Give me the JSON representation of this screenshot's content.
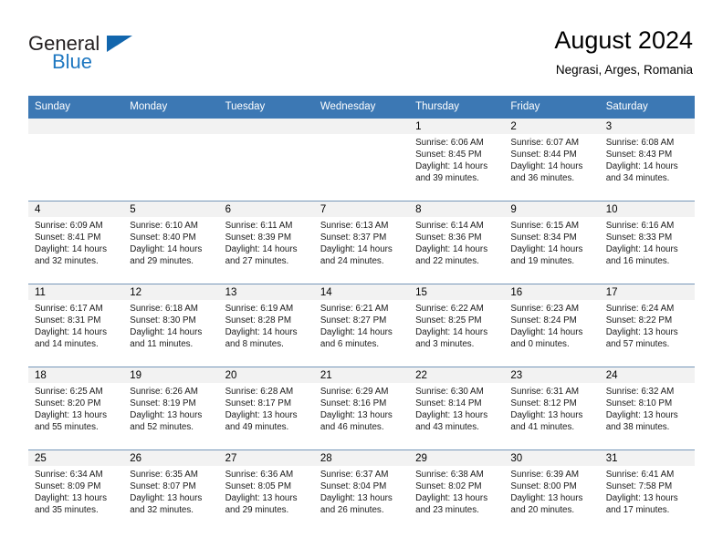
{
  "brand": {
    "name_top": "General",
    "name_bottom": "Blue",
    "triangle_color": "#1266ad",
    "blue_color": "#1f78c1"
  },
  "header": {
    "title": "August 2024",
    "subtitle": "Negrasi, Arges, Romania"
  },
  "calendar": {
    "header_bg": "#3c78b4",
    "weekdays": [
      "Sunday",
      "Monday",
      "Tuesday",
      "Wednesday",
      "Thursday",
      "Friday",
      "Saturday"
    ],
    "weeks": [
      [
        {
          "day": "",
          "empty": true
        },
        {
          "day": "",
          "empty": true
        },
        {
          "day": "",
          "empty": true
        },
        {
          "day": "",
          "empty": true
        },
        {
          "day": "1",
          "sunrise": "Sunrise: 6:06 AM",
          "sunset": "Sunset: 8:45 PM",
          "daylight": "Daylight: 14 hours and 39 minutes."
        },
        {
          "day": "2",
          "sunrise": "Sunrise: 6:07 AM",
          "sunset": "Sunset: 8:44 PM",
          "daylight": "Daylight: 14 hours and 36 minutes."
        },
        {
          "day": "3",
          "sunrise": "Sunrise: 6:08 AM",
          "sunset": "Sunset: 8:43 PM",
          "daylight": "Daylight: 14 hours and 34 minutes."
        }
      ],
      [
        {
          "day": "4",
          "sunrise": "Sunrise: 6:09 AM",
          "sunset": "Sunset: 8:41 PM",
          "daylight": "Daylight: 14 hours and 32 minutes."
        },
        {
          "day": "5",
          "sunrise": "Sunrise: 6:10 AM",
          "sunset": "Sunset: 8:40 PM",
          "daylight": "Daylight: 14 hours and 29 minutes."
        },
        {
          "day": "6",
          "sunrise": "Sunrise: 6:11 AM",
          "sunset": "Sunset: 8:39 PM",
          "daylight": "Daylight: 14 hours and 27 minutes."
        },
        {
          "day": "7",
          "sunrise": "Sunrise: 6:13 AM",
          "sunset": "Sunset: 8:37 PM",
          "daylight": "Daylight: 14 hours and 24 minutes."
        },
        {
          "day": "8",
          "sunrise": "Sunrise: 6:14 AM",
          "sunset": "Sunset: 8:36 PM",
          "daylight": "Daylight: 14 hours and 22 minutes."
        },
        {
          "day": "9",
          "sunrise": "Sunrise: 6:15 AM",
          "sunset": "Sunset: 8:34 PM",
          "daylight": "Daylight: 14 hours and 19 minutes."
        },
        {
          "day": "10",
          "sunrise": "Sunrise: 6:16 AM",
          "sunset": "Sunset: 8:33 PM",
          "daylight": "Daylight: 14 hours and 16 minutes."
        }
      ],
      [
        {
          "day": "11",
          "sunrise": "Sunrise: 6:17 AM",
          "sunset": "Sunset: 8:31 PM",
          "daylight": "Daylight: 14 hours and 14 minutes."
        },
        {
          "day": "12",
          "sunrise": "Sunrise: 6:18 AM",
          "sunset": "Sunset: 8:30 PM",
          "daylight": "Daylight: 14 hours and 11 minutes."
        },
        {
          "day": "13",
          "sunrise": "Sunrise: 6:19 AM",
          "sunset": "Sunset: 8:28 PM",
          "daylight": "Daylight: 14 hours and 8 minutes."
        },
        {
          "day": "14",
          "sunrise": "Sunrise: 6:21 AM",
          "sunset": "Sunset: 8:27 PM",
          "daylight": "Daylight: 14 hours and 6 minutes."
        },
        {
          "day": "15",
          "sunrise": "Sunrise: 6:22 AM",
          "sunset": "Sunset: 8:25 PM",
          "daylight": "Daylight: 14 hours and 3 minutes."
        },
        {
          "day": "16",
          "sunrise": "Sunrise: 6:23 AM",
          "sunset": "Sunset: 8:24 PM",
          "daylight": "Daylight: 14 hours and 0 minutes."
        },
        {
          "day": "17",
          "sunrise": "Sunrise: 6:24 AM",
          "sunset": "Sunset: 8:22 PM",
          "daylight": "Daylight: 13 hours and 57 minutes."
        }
      ],
      [
        {
          "day": "18",
          "sunrise": "Sunrise: 6:25 AM",
          "sunset": "Sunset: 8:20 PM",
          "daylight": "Daylight: 13 hours and 55 minutes."
        },
        {
          "day": "19",
          "sunrise": "Sunrise: 6:26 AM",
          "sunset": "Sunset: 8:19 PM",
          "daylight": "Daylight: 13 hours and 52 minutes."
        },
        {
          "day": "20",
          "sunrise": "Sunrise: 6:28 AM",
          "sunset": "Sunset: 8:17 PM",
          "daylight": "Daylight: 13 hours and 49 minutes."
        },
        {
          "day": "21",
          "sunrise": "Sunrise: 6:29 AM",
          "sunset": "Sunset: 8:16 PM",
          "daylight": "Daylight: 13 hours and 46 minutes."
        },
        {
          "day": "22",
          "sunrise": "Sunrise: 6:30 AM",
          "sunset": "Sunset: 8:14 PM",
          "daylight": "Daylight: 13 hours and 43 minutes."
        },
        {
          "day": "23",
          "sunrise": "Sunrise: 6:31 AM",
          "sunset": "Sunset: 8:12 PM",
          "daylight": "Daylight: 13 hours and 41 minutes."
        },
        {
          "day": "24",
          "sunrise": "Sunrise: 6:32 AM",
          "sunset": "Sunset: 8:10 PM",
          "daylight": "Daylight: 13 hours and 38 minutes."
        }
      ],
      [
        {
          "day": "25",
          "sunrise": "Sunrise: 6:34 AM",
          "sunset": "Sunset: 8:09 PM",
          "daylight": "Daylight: 13 hours and 35 minutes."
        },
        {
          "day": "26",
          "sunrise": "Sunrise: 6:35 AM",
          "sunset": "Sunset: 8:07 PM",
          "daylight": "Daylight: 13 hours and 32 minutes."
        },
        {
          "day": "27",
          "sunrise": "Sunrise: 6:36 AM",
          "sunset": "Sunset: 8:05 PM",
          "daylight": "Daylight: 13 hours and 29 minutes."
        },
        {
          "day": "28",
          "sunrise": "Sunrise: 6:37 AM",
          "sunset": "Sunset: 8:04 PM",
          "daylight": "Daylight: 13 hours and 26 minutes."
        },
        {
          "day": "29",
          "sunrise": "Sunrise: 6:38 AM",
          "sunset": "Sunset: 8:02 PM",
          "daylight": "Daylight: 13 hours and 23 minutes."
        },
        {
          "day": "30",
          "sunrise": "Sunrise: 6:39 AM",
          "sunset": "Sunset: 8:00 PM",
          "daylight": "Daylight: 13 hours and 20 minutes."
        },
        {
          "day": "31",
          "sunrise": "Sunrise: 6:41 AM",
          "sunset": "Sunset: 7:58 PM",
          "daylight": "Daylight: 13 hours and 17 minutes."
        }
      ]
    ]
  }
}
